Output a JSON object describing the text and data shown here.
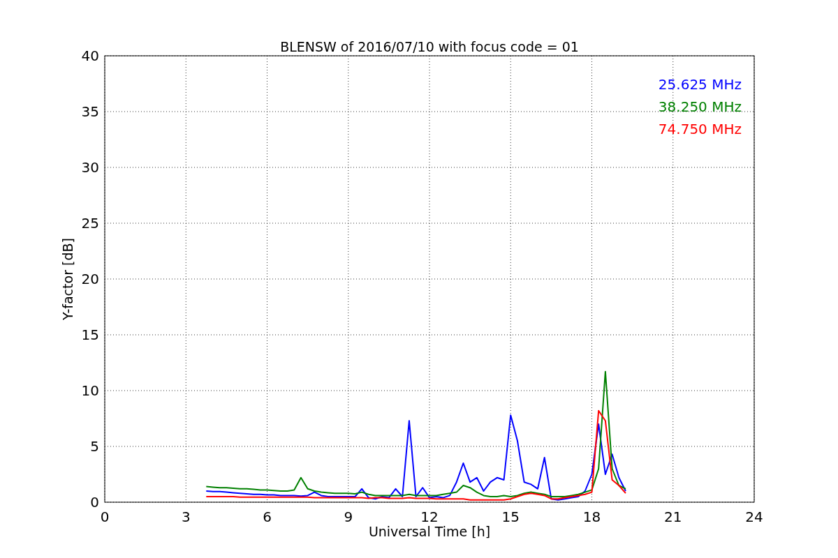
{
  "chart_data": {
    "type": "line",
    "grid": true,
    "title": "BLENSW of 2016/07/10 with focus code = 01",
    "xlabel": "Universal Time [h]",
    "ylabel": "Y-factor [dB]",
    "xlim": [
      0,
      24
    ],
    "ylim": [
      0,
      40
    ],
    "xticks": [
      0,
      3,
      6,
      9,
      12,
      15,
      18,
      21,
      24
    ],
    "yticks": [
      0,
      5,
      10,
      15,
      20,
      25,
      30,
      35,
      40
    ],
    "x": [
      3.75,
      4.0,
      4.25,
      4.5,
      4.75,
      5.0,
      5.25,
      5.5,
      5.75,
      6.0,
      6.25,
      6.5,
      6.75,
      7.0,
      7.25,
      7.5,
      7.75,
      8.0,
      8.25,
      8.5,
      8.75,
      9.0,
      9.25,
      9.5,
      9.75,
      10.0,
      10.25,
      10.5,
      10.75,
      11.0,
      11.25,
      11.5,
      11.75,
      12.0,
      12.25,
      12.5,
      12.75,
      13.0,
      13.25,
      13.5,
      13.75,
      14.0,
      14.25,
      14.5,
      14.75,
      15.0,
      15.25,
      15.5,
      15.75,
      16.0,
      16.25,
      16.5,
      16.75,
      17.0,
      17.25,
      17.5,
      17.75,
      18.0,
      18.25,
      18.5,
      18.75,
      19.0,
      19.25
    ],
    "series": [
      {
        "name": "25.625 MHz",
        "color": "#0000ff",
        "values": [
          1.0,
          0.95,
          0.95,
          0.9,
          0.85,
          0.8,
          0.75,
          0.7,
          0.7,
          0.65,
          0.65,
          0.6,
          0.6,
          0.6,
          0.55,
          0.6,
          0.9,
          0.6,
          0.5,
          0.5,
          0.5,
          0.5,
          0.5,
          1.2,
          0.4,
          0.3,
          0.5,
          0.4,
          1.2,
          0.5,
          7.3,
          0.5,
          1.3,
          0.4,
          0.5,
          0.4,
          0.6,
          1.8,
          3.5,
          1.8,
          2.2,
          1.0,
          1.8,
          2.2,
          2.0,
          7.8,
          5.5,
          1.8,
          1.6,
          1.2,
          4.0,
          0.3,
          0.2,
          0.3,
          0.4,
          0.5,
          1.0,
          2.5,
          7.0,
          2.5,
          4.3,
          2.2,
          1.0
        ]
      },
      {
        "name": "38.250 MHz",
        "color": "#008000",
        "values": [
          1.4,
          1.35,
          1.3,
          1.3,
          1.25,
          1.2,
          1.2,
          1.15,
          1.1,
          1.1,
          1.05,
          1.0,
          1.0,
          1.1,
          2.2,
          1.2,
          1.0,
          0.9,
          0.85,
          0.8,
          0.8,
          0.8,
          0.75,
          0.9,
          0.7,
          0.6,
          0.6,
          0.6,
          0.6,
          0.6,
          0.7,
          0.6,
          0.6,
          0.6,
          0.6,
          0.7,
          0.8,
          0.9,
          1.5,
          1.3,
          0.9,
          0.6,
          0.5,
          0.5,
          0.6,
          0.5,
          0.6,
          0.8,
          0.9,
          0.8,
          0.7,
          0.5,
          0.5,
          0.5,
          0.6,
          0.7,
          0.9,
          1.1,
          3.0,
          11.7,
          3.0,
          1.5,
          1.2
        ]
      },
      {
        "name": "74.750 MHz",
        "color": "#ff0000",
        "values": [
          0.5,
          0.5,
          0.5,
          0.5,
          0.5,
          0.45,
          0.45,
          0.45,
          0.45,
          0.45,
          0.45,
          0.45,
          0.45,
          0.45,
          0.45,
          0.45,
          0.4,
          0.4,
          0.4,
          0.4,
          0.4,
          0.4,
          0.4,
          0.4,
          0.35,
          0.4,
          0.4,
          0.35,
          0.35,
          0.35,
          0.4,
          0.35,
          0.35,
          0.35,
          0.3,
          0.3,
          0.3,
          0.3,
          0.3,
          0.2,
          0.2,
          0.2,
          0.2,
          0.2,
          0.2,
          0.3,
          0.5,
          0.7,
          0.8,
          0.7,
          0.6,
          0.3,
          0.3,
          0.4,
          0.5,
          0.6,
          0.7,
          0.9,
          8.2,
          7.3,
          2.0,
          1.5,
          0.8
        ]
      }
    ]
  }
}
